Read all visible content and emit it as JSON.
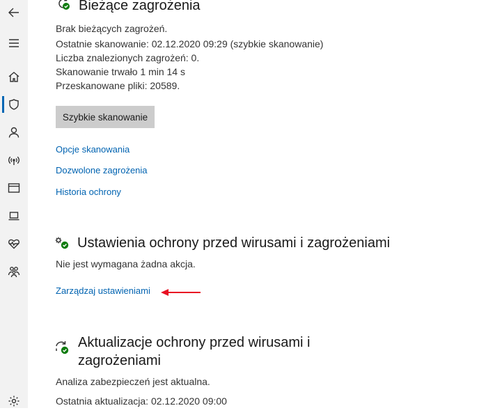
{
  "sidebar": {
    "items": [
      {
        "name": "back-arrow-icon"
      },
      {
        "name": "hamburger-menu-icon"
      },
      {
        "name": "home-icon"
      },
      {
        "name": "shield-icon"
      },
      {
        "name": "account-icon"
      },
      {
        "name": "network-icon"
      },
      {
        "name": "app-browser-icon"
      },
      {
        "name": "device-security-icon"
      },
      {
        "name": "device-health-icon"
      },
      {
        "name": "family-icon"
      },
      {
        "name": "settings-icon"
      }
    ],
    "active_item": "shield-icon"
  },
  "current_threats": {
    "title": "Bieżące zagrożenia",
    "status": "Brak bieżących zagrożeń.",
    "last_scan": "Ostatnie skanowanie: 02.12.2020 09:29 (szybkie skanowanie)",
    "threats_found": "Liczba znalezionych zagrożeń: 0.",
    "duration": "Skanowanie trwało 1 min 14 s",
    "files_scanned": "Przeskanowane pliki: 20589.",
    "quick_scan_button": "Szybkie skanowanie",
    "links": [
      "Opcje skanowania",
      "Dozwolone zagrożenia",
      "Historia ochrony"
    ]
  },
  "protection_settings": {
    "title": "Ustawienia ochrony przed wirusami i zagrożeniami",
    "status": "Nie jest wymagana żadna akcja.",
    "manage_link": "Zarządzaj ustawieniami"
  },
  "protection_updates": {
    "title_line1": "Aktualizacje ochrony przed wirusami i",
    "title_line2": "zagrożeniami",
    "status": "Analiza zabezpieczeń jest aktualna.",
    "last_update": "Ostatnia aktualizacja: 02.12.2020 09:00"
  },
  "colors": {
    "accent": "#0066b4",
    "link": "#0063b1",
    "ok_green": "#107c10",
    "annotation_arrow": "#e81123"
  }
}
